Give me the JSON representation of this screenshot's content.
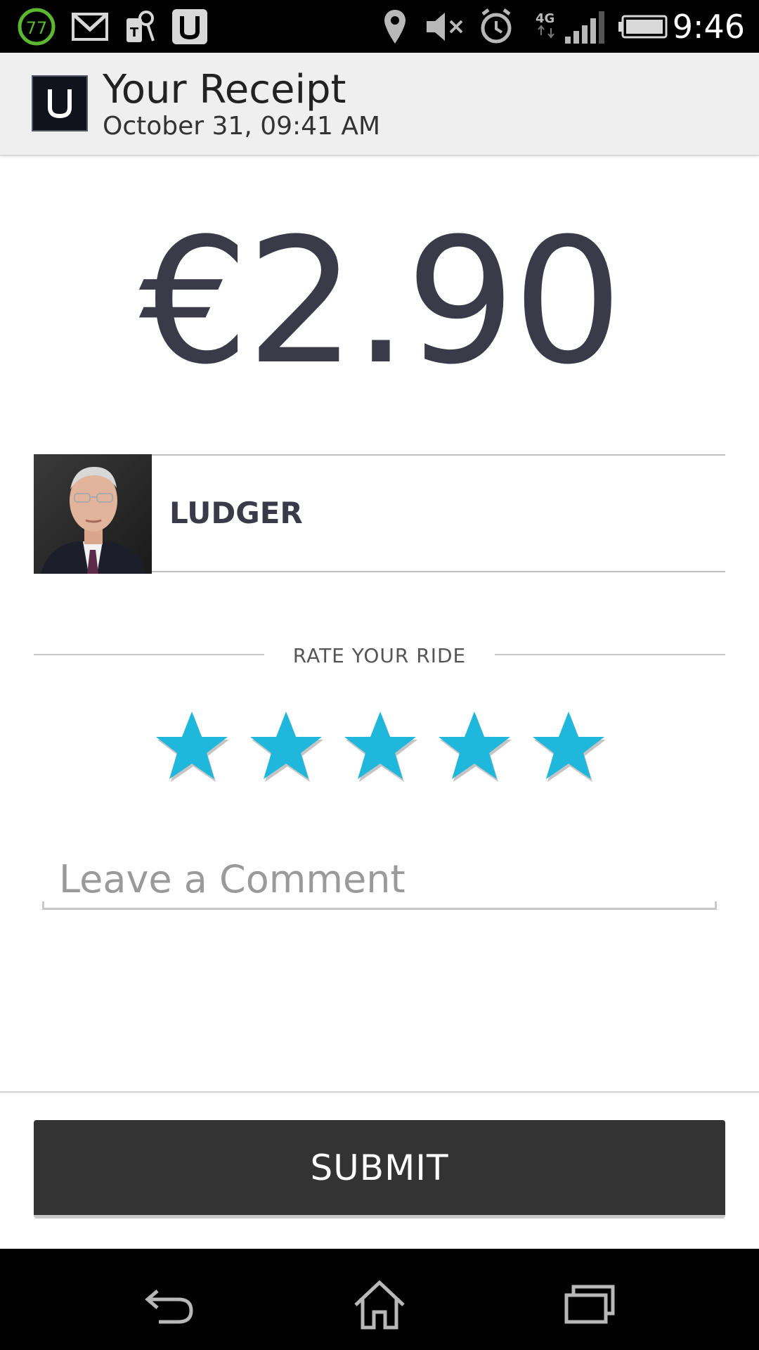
{
  "status_bar": {
    "time": "9:46",
    "badge_number": "77",
    "network_type": "4G",
    "icons": [
      "battery-saver-badge-icon",
      "gmail-icon",
      "telekom-keys-icon",
      "uber-icon",
      "location-icon",
      "mute-icon",
      "alarm-icon",
      "signal-icon",
      "battery-icon"
    ]
  },
  "action_bar": {
    "title": "Your Receipt",
    "subtitle": "October 31, 09:41 AM"
  },
  "receipt": {
    "amount": "€2.90"
  },
  "driver": {
    "name": "LUDGER"
  },
  "rating": {
    "label": "RATE YOUR RIDE",
    "stars_filled": 5,
    "stars_total": 5,
    "star_color": "#1fb8dc"
  },
  "comment": {
    "placeholder": "Leave a Comment",
    "value": ""
  },
  "submit": {
    "label": "SUBMIT"
  },
  "colors": {
    "amount_text": "#3a3a48",
    "submit_bg": "#333333",
    "accent_star": "#1fb8dc"
  }
}
